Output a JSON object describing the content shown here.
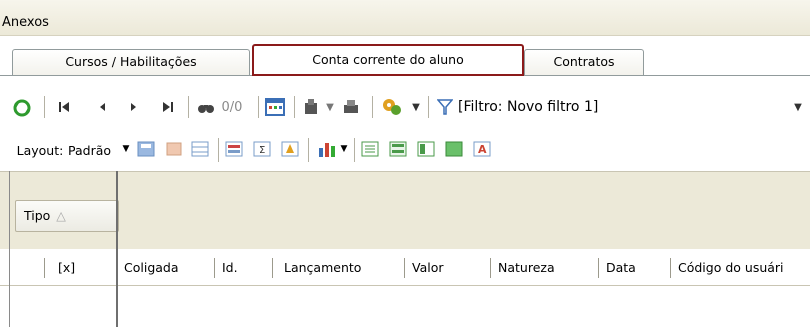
{
  "window": {
    "title": "Anexos"
  },
  "tabs": [
    {
      "label": "Cursos / Habilitações",
      "active": false
    },
    {
      "label": "Conta corrente do aluno",
      "active": true
    },
    {
      "label": "Contratos",
      "active": false
    }
  ],
  "toolbar1": {
    "record_counter": "0/0",
    "filter_label": "[Filtro: Novo filtro 1]",
    "icons": [
      "refresh-icon",
      "first-record-icon",
      "prev-record-icon",
      "next-record-icon",
      "last-record-icon",
      "search-icon",
      "grid-icon",
      "attach-icon",
      "print-icon",
      "process-icon",
      "filter-icon"
    ]
  },
  "toolbar2": {
    "layout_label": "Layout:",
    "layout_value": "Padrão"
  },
  "grouping": {
    "group_button": "Tipo",
    "sort_indicator": "△"
  },
  "grid": {
    "columns": [
      "[x]",
      "Coligada",
      "Id.",
      "Lançamento",
      "Valor",
      "Natureza",
      "Data",
      "Código do usuári"
    ]
  },
  "colors": {
    "active_tab_border": "#8b1a1a",
    "refresh_green": "#2e9a2e",
    "group_area_bg": "#ece9d8"
  }
}
